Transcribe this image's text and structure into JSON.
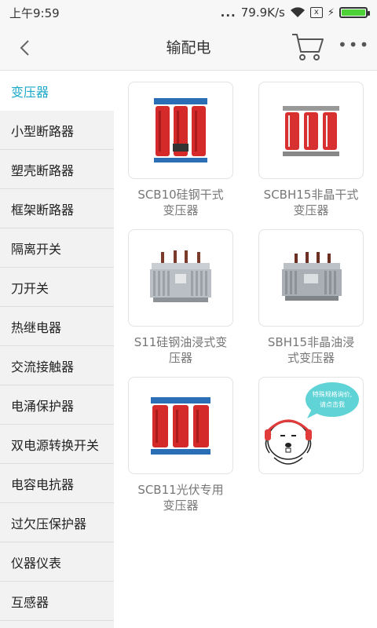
{
  "status_bar": {
    "time": "上午9:59",
    "dots": "...",
    "speed": "79.9K/s",
    "sim_icon": "x",
    "battery_color": "#4cd137"
  },
  "nav": {
    "title": "输配电",
    "back_icon": "chevron-left-icon",
    "cart_icon": "cart-icon",
    "more_icon": "more-dots-icon"
  },
  "sidebar": {
    "accent_color": "#1aa9c8",
    "items": [
      {
        "label": "变压器"
      },
      {
        "label": "小型断路器"
      },
      {
        "label": "塑壳断路器"
      },
      {
        "label": "框架断路器"
      },
      {
        "label": "隔离开关"
      },
      {
        "label": "刀开关"
      },
      {
        "label": "热继电器"
      },
      {
        "label": "交流接触器"
      },
      {
        "label": "电涌保护器"
      },
      {
        "label": "双电源转换开关"
      },
      {
        "label": "电容电抗器"
      },
      {
        "label": "过欠压保护器"
      },
      {
        "label": "仪器仪表"
      },
      {
        "label": "互感器"
      }
    ]
  },
  "products": [
    {
      "name_line1": "SCB10硅钢干式",
      "name_line2": "变压器"
    },
    {
      "name_line1": "SCBH15非晶干式",
      "name_line2": "变压器"
    },
    {
      "name_line1": "S11硅钢油浸式变",
      "name_line2": "压器"
    },
    {
      "name_line1": "SBH15非晶油浸",
      "name_line2": "式变压器"
    },
    {
      "name_line1": "SCB11光伏专用",
      "name_line2": "变压器"
    }
  ],
  "helper": {
    "bubble_line1": "特殊规格询价,",
    "bubble_line2": "请点击我"
  }
}
